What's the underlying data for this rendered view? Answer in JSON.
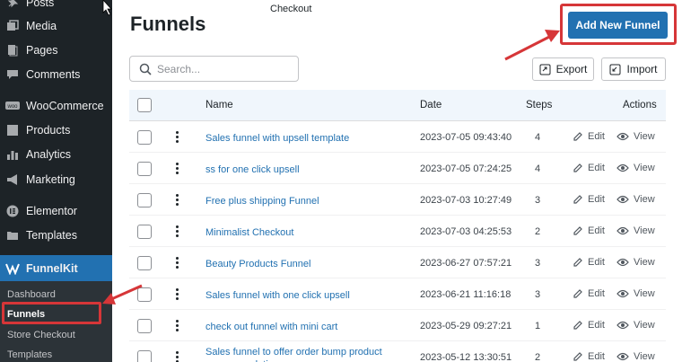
{
  "sidebar": {
    "items": [
      {
        "label": "Posts",
        "icon": "pin-icon"
      },
      {
        "label": "Media",
        "icon": "media-icon"
      },
      {
        "label": "Pages",
        "icon": "page-icon"
      },
      {
        "label": "Comments",
        "icon": "comment-icon"
      },
      {
        "label": "WooCommerce",
        "icon": "woo-icon"
      },
      {
        "label": "Products",
        "icon": "box-icon"
      },
      {
        "label": "Analytics",
        "icon": "bar-chart-icon"
      },
      {
        "label": "Marketing",
        "icon": "megaphone-icon"
      },
      {
        "label": "Elementor",
        "icon": "elementor-icon"
      },
      {
        "label": "Templates",
        "icon": "folder-icon"
      }
    ],
    "active": {
      "label": "FunnelKit",
      "icon": "funnelkit-icon"
    },
    "submenu": [
      "Dashboard",
      "Funnels",
      "Store Checkout",
      "Templates"
    ]
  },
  "header": {
    "title": "Funnels",
    "tab_text": "Checkout",
    "add_button": "Add New Funnel"
  },
  "toolbar": {
    "search_placeholder": "Search...",
    "export_label": "Export",
    "import_label": "Import"
  },
  "table": {
    "columns": {
      "name": "Name",
      "date": "Date",
      "steps": "Steps",
      "actions": "Actions"
    },
    "edit_label": "Edit",
    "view_label": "View",
    "rows": [
      {
        "name": "Sales funnel with upsell template",
        "date": "2023-07-05 09:43:40",
        "steps": "4"
      },
      {
        "name": "ss for one click upsell",
        "date": "2023-07-05 07:24:25",
        "steps": "4"
      },
      {
        "name": "Free plus shipping Funnel",
        "date": "2023-07-03 10:27:49",
        "steps": "3"
      },
      {
        "name": "Minimalist Checkout",
        "date": "2023-07-03 04:25:53",
        "steps": "2"
      },
      {
        "name": "Beauty Products Funnel",
        "date": "2023-06-27 07:57:21",
        "steps": "3"
      },
      {
        "name": "Sales funnel with one click upsell",
        "date": "2023-06-21 11:16:18",
        "steps": "3"
      },
      {
        "name": "check out funnel with mini cart",
        "date": "2023-05-29 09:27:21",
        "steps": "1"
      },
      {
        "name": "Sales funnel to offer order bump product recommendation",
        "date": "2023-05-12 13:30:51",
        "steps": "2"
      }
    ]
  },
  "colors": {
    "sidebar_bg": "#1d2327",
    "accent": "#2271b1",
    "annotation": "#d63638"
  }
}
